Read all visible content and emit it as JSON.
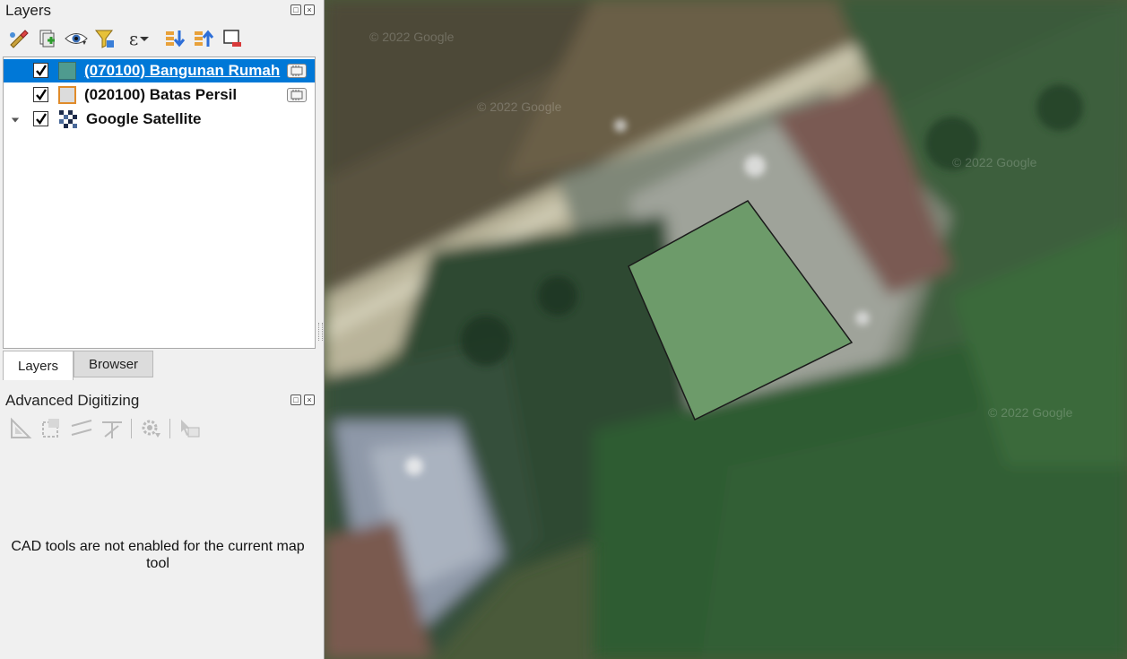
{
  "layers_panel": {
    "title": "Layers",
    "float_label": "□",
    "close_label": "×",
    "toolbar": [
      {
        "name": "open-layer-styling-icon"
      },
      {
        "name": "add-group-icon"
      },
      {
        "name": "manage-map-themes-icon"
      },
      {
        "name": "filter-legend-icon"
      },
      {
        "name": "filter-by-expression-icon",
        "glyph": "ε"
      },
      {
        "name": "expand-all-icon"
      },
      {
        "name": "collapse-all-icon"
      },
      {
        "name": "remove-layer-icon"
      }
    ],
    "layers": [
      {
        "label": "(070100) Bangunan Rumah",
        "checked": true,
        "selected": true,
        "symbol_fill": "#4f9b8f",
        "symbol_border": "#3b7068"
      },
      {
        "label": "(020100) Batas Persil",
        "checked": true,
        "selected": false,
        "symbol_fill": "#dcdcdc",
        "symbol_border": "#e08b2a"
      },
      {
        "label": "Google Satellite",
        "checked": true,
        "selected": false
      }
    ]
  },
  "tabs": [
    {
      "label": "Layers",
      "active": true
    },
    {
      "label": "Browser",
      "active": false
    }
  ],
  "advanced_digitizing": {
    "title": "Advanced Digitizing",
    "float_label": "□",
    "close_label": "×",
    "message": "CAD tools are not enabled for the current map tool"
  },
  "map": {
    "watermarks": [
      "© 2022 Google",
      "© 2022 Google",
      "© 2022 Google",
      "© 2022 Google"
    ],
    "polygon_fill": "#6d9b6a",
    "polygon_stroke": "#1a1a1a"
  }
}
